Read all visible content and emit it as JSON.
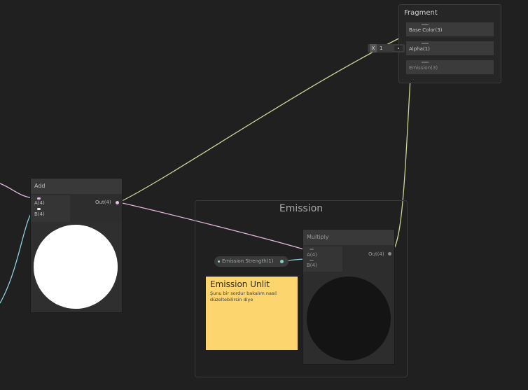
{
  "fragment": {
    "title": "Fragment",
    "slots": [
      {
        "label": "Base Color(3)"
      },
      {
        "label": "Alpha(1)"
      },
      {
        "label": "Emission(3)"
      }
    ]
  },
  "alpha_input": {
    "axis": "X",
    "value": "1"
  },
  "add_node": {
    "title": "Add",
    "inputs": [
      "A(4)",
      "B(4)"
    ],
    "output": "Out(4)"
  },
  "emission_group": {
    "title": "Emission"
  },
  "multiply_node": {
    "title": "Multiply",
    "inputs": [
      "A(4)",
      "B(4)"
    ],
    "output": "Out(4)"
  },
  "emission_strength": {
    "label": "Emission Strength(1)"
  },
  "sticky_note": {
    "title": "Emission Unlit",
    "body": "Şunu bir sordur bakalım nasıl düzeltebilirsin diye"
  },
  "colors": {
    "background": "#202020",
    "wire_pink": "#e0b6da",
    "wire_green": "#c8d79a",
    "wire_cyan": "#8ed0e0",
    "sticky": "#fdd56e"
  }
}
